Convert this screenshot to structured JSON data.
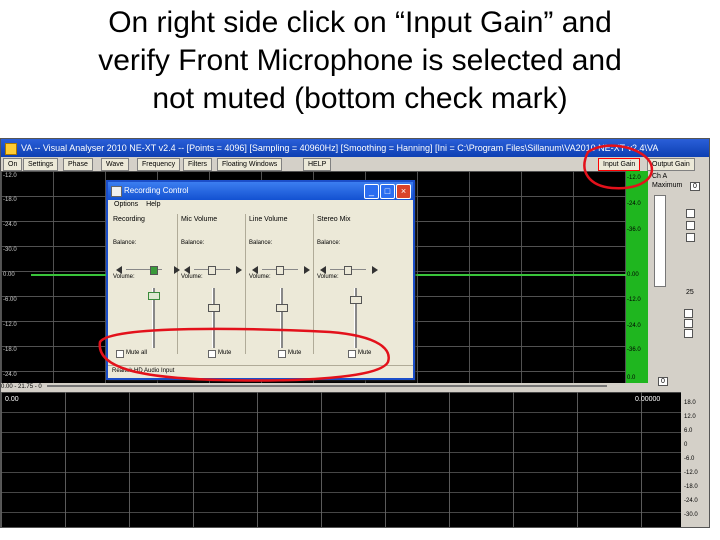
{
  "heading": {
    "line1": "On right side click on “Input Gain” and",
    "line2": "verify Front Microphone is selected and",
    "line3": "not muted (bottom check mark)"
  },
  "app": {
    "title": "VA -- Visual Analyser 2010 NE-XT v2.4 -- [Points = 4096] [Sampling = 40960Hz] [Smoothing = Hanning] [Ini = C:\\Program Files\\Sillanum\\VA2010 NE-XT v2.4\\VA",
    "toolbar": [
      "On",
      "Settings",
      "Phase",
      "Wave",
      "Frequency",
      "Filters",
      "Floating Windows",
      "HELP"
    ],
    "input_gain": "Input Gain",
    "output_gain": "Output Gain",
    "scope_y_labels": [
      "-12.0",
      "-18.0",
      "-24.0",
      "-30.0",
      "0.00",
      "-6.00",
      "-12.0",
      "-18.0",
      "-24.0"
    ],
    "meter_labels": [
      "-12.0",
      "-24.0",
      "-36.0",
      "0.00",
      "-12.0",
      "-24.0",
      "-36.0",
      "0.0"
    ],
    "meter_bottom": "0.0",
    "status_left": "0.00 - 21.75 - 0",
    "spectrum_left": "0.00",
    "spectrum_right": "0.00000",
    "right_panel": {
      "ch_label": "Ch A",
      "line1": "Maximum",
      "counter_top": "0",
      "counter_bottom": "0",
      "value": "25"
    },
    "spectrum_scale": [
      "18.0",
      "12.0",
      "6.0",
      "0",
      "-6.0",
      "-12.0",
      "-18.0",
      "-24.0",
      "-30.0"
    ]
  },
  "dialog": {
    "title": "Recording Control",
    "menu": [
      "Options",
      "Help"
    ],
    "columns": [
      {
        "name": "Recording",
        "mute_label": "Mute all"
      },
      {
        "name": "Mic Volume",
        "mute_label": "Mute"
      },
      {
        "name": "Line Volume",
        "mute_label": "Mute"
      },
      {
        "name": "Stereo Mix",
        "mute_label": "Mute"
      }
    ],
    "balance_label": "Balance:",
    "volume_label": "Volume:",
    "status": "Realtek HD Audio Input"
  },
  "annotation_color": "#e3111b"
}
